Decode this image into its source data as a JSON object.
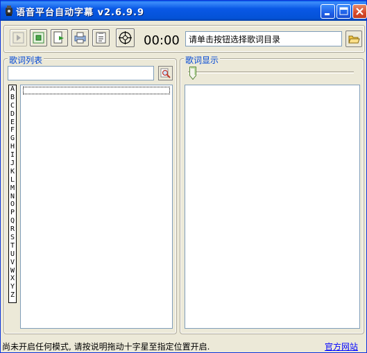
{
  "window": {
    "title": "语音平台自动字幕 v2.6.9.9"
  },
  "toolbar": {
    "buttons": [
      {
        "icon": "play-icon",
        "enabled": false
      },
      {
        "icon": "stop-icon",
        "enabled": true
      },
      {
        "icon": "export-icon",
        "enabled": true
      },
      {
        "icon": "print-icon",
        "enabled": true
      },
      {
        "icon": "clipboard-icon",
        "enabled": true
      },
      {
        "icon": "crosshair-icon",
        "enabled": true
      }
    ],
    "time": "00:00",
    "directory_text": "请单击按钮选择歌词目录",
    "open_icon": "folder-open-icon"
  },
  "lyrics_list": {
    "title": "歌词列表",
    "search_value": "",
    "search_icon": "search-icon",
    "alphabet": [
      "A",
      "B",
      "C",
      "D",
      "E",
      "F",
      "G",
      "H",
      "I",
      "J",
      "K",
      "L",
      "M",
      "N",
      "O",
      "P",
      "Q",
      "R",
      "S",
      "T",
      "U",
      "V",
      "W",
      "X",
      "Y",
      "Z"
    ]
  },
  "lyrics_display": {
    "title": "歌词显示",
    "slider_value": 0
  },
  "status": {
    "message": "尚未开启任何模式, 请按说明拖动十字星至指定位置开启.",
    "link": "官方网站"
  },
  "colors": {
    "titlebar": "#0a5fe8",
    "group_title": "#0046d5",
    "link": "#0000ff",
    "background": "#ece9d8"
  }
}
